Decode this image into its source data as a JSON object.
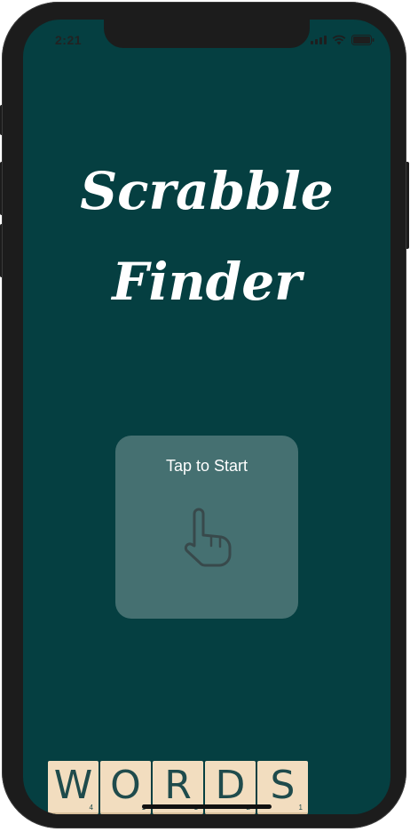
{
  "status_bar": {
    "time": "2:21"
  },
  "app": {
    "title_line1": "Scrabble",
    "title_line2": "Finder"
  },
  "start_card": {
    "label": "Tap to Start",
    "icon": "pointing-hand-icon"
  },
  "tiles": [
    {
      "letter": "W",
      "score": "4"
    },
    {
      "letter": "O",
      "score": "1"
    },
    {
      "letter": "R",
      "score": "1"
    },
    {
      "letter": "D",
      "score": "2"
    },
    {
      "letter": "S",
      "score": "1"
    }
  ],
  "colors": {
    "background": "#053f41",
    "card": "#457071",
    "tile": "#f2ddbf",
    "tile_text": "#1f4b4c"
  }
}
